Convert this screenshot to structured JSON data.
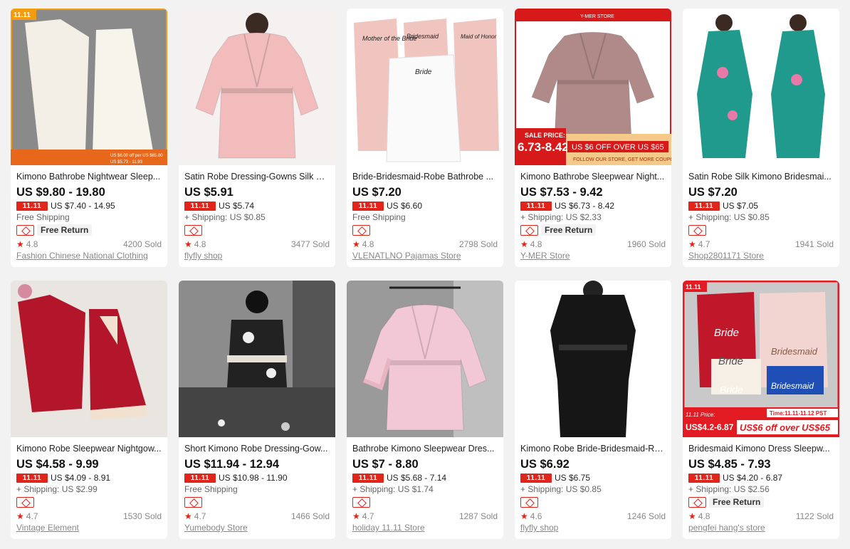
{
  "products": [
    {
      "title": "Kimono Bathrobe Nightwear Sleep...",
      "price": "US $9.80 - 19.80",
      "badge": "11.11",
      "promo_price": "US $7.40 - 14.95",
      "shipping": "Free Shipping",
      "free_return": true,
      "free_return_label": "Free Return",
      "rating": "4.8",
      "sold": "4200 Sold",
      "store": "Fashion Chinese National Clothing",
      "image_overlay": {
        "corner_tag": "11.11",
        "strip_text": "US $6.00 off per US $65.00",
        "price_text": "US $5.73 - 11.93"
      },
      "colors": {
        "bg": "#8a8a8a",
        "main": "#f3efe6"
      }
    },
    {
      "title": "Satin Robe Dressing-Gowns Silk Ki...",
      "price": "US $5.91",
      "badge": "11.11",
      "promo_price": "US $5.74",
      "shipping": "+ Shipping: US $0.85",
      "free_return": false,
      "rating": "4.8",
      "sold": "3477 Sold",
      "store": "flyfly shop",
      "colors": {
        "bg": "#f4f1f0",
        "main": "#f2bcbc"
      }
    },
    {
      "title": "Bride-Bridesmaid-Robe Bathrobe ...",
      "price": "US $7.20",
      "badge": "11.11",
      "promo_price": "US $6.60",
      "shipping": "Free Shipping",
      "free_return": false,
      "rating": "4.8",
      "sold": "2798 Sold",
      "store": "VLENATLNO Pajamas Store",
      "image_overlay": {
        "labels": [
          "Mother of the Bride",
          "Bridesmaid",
          "Maid of Honor",
          "Bride"
        ]
      },
      "colors": {
        "bg": "#ffffff",
        "main": "#f0c4bf"
      }
    },
    {
      "title": "Kimono Bathrobe Sleepwear Night...",
      "price": "US $7.53 - 9.42",
      "badge": "11.11",
      "promo_price": "US $6.73 - 8.42",
      "shipping": "+ Shipping: US $2.33",
      "free_return": true,
      "free_return_label": "Free Return",
      "rating": "4.8",
      "sold": "1960 Sold",
      "store": "Y-MER Store",
      "image_overlay": {
        "store_tag": "Y-MER STORE",
        "sale_label": "SALE PRICE:",
        "sale_price": "6.73-8.42",
        "offer": "US $6 OFF OVER US $65",
        "follow": "FOLLOW OUR STORE, GET MORE COUPONS"
      },
      "colors": {
        "bg": "#ffffff",
        "main": "#b08a88"
      }
    },
    {
      "title": "Satin Robe Silk Kimono Bridesmai...",
      "price": "US $7.20",
      "badge": "11.11",
      "promo_price": "US $7.05",
      "shipping": "+ Shipping: US $0.85",
      "free_return": false,
      "rating": "4.7",
      "sold": "1941 Sold",
      "store": "Shop2801171 Store",
      "colors": {
        "bg": "#ffffff",
        "main": "#1f9a8c"
      }
    },
    {
      "title": "Kimono Robe Sleepwear Nightgow...",
      "price": "US $4.58 - 9.99",
      "badge": "11.11",
      "promo_price": "US $4.09 - 8.91",
      "shipping": "+ Shipping: US $2.99",
      "free_return": false,
      "rating": "4.7",
      "sold": "1530 Sold",
      "store": "Vintage Element",
      "colors": {
        "bg": "#e9e6e2",
        "main": "#b3152a"
      }
    },
    {
      "title": "Short Kimono Robe Dressing-Gow...",
      "price": "US $11.94 - 12.94",
      "badge": "11.11",
      "promo_price": "US $10.98 - 11.90",
      "shipping": "Free Shipping",
      "free_return": false,
      "rating": "4.7",
      "sold": "1466 Sold",
      "store": "Yumebody Store",
      "colors": {
        "bg": "#8c8c8c",
        "main": "#222222"
      }
    },
    {
      "title": "Bathrobe Kimono Sleepwear Dres...",
      "price": "US $7 - 8.80",
      "badge": "11.11",
      "promo_price": "US $5.68 - 7.14",
      "shipping": "+ Shipping: US $1.74",
      "free_return": false,
      "rating": "4.7",
      "sold": "1287 Sold",
      "store": "holiday 11.11 Store",
      "colors": {
        "bg": "#9a9a9a",
        "main": "#f2c8d6"
      }
    },
    {
      "title": "Kimono Robe Bride-Bridesmaid-Ro...",
      "price": "US $6.92",
      "badge": "11.11",
      "promo_price": "US $6.75",
      "shipping": "+ Shipping: US $0.85",
      "free_return": false,
      "rating": "4.6",
      "sold": "1246 Sold",
      "store": "flyfly shop",
      "colors": {
        "bg": "#ffffff",
        "main": "#161616"
      }
    },
    {
      "title": "Bridesmaid Kimono Dress Sleepw...",
      "price": "US $4.85 - 7.93",
      "badge": "11.11",
      "promo_price": "US $4.20 - 6.87",
      "shipping": "+ Shipping: US $2.56",
      "free_return": true,
      "free_return_label": "Free Return",
      "rating": "4.8",
      "sold": "1122 Sold",
      "store": "pengfei hang's store",
      "image_overlay": {
        "corner_tag": "11.11",
        "labels": [
          "Bride",
          "Bridesmaid",
          "Bride",
          "Bride",
          "Bridesmaid"
        ],
        "price_label": "11.11 Price:",
        "price_text": "US$4.2-6.87",
        "time_text": "Time:11.11-11.12 PST",
        "offer": "US$6 off over US$65"
      },
      "colors": {
        "bg": "#f2f2f2",
        "main": "#c0172b"
      }
    }
  ]
}
